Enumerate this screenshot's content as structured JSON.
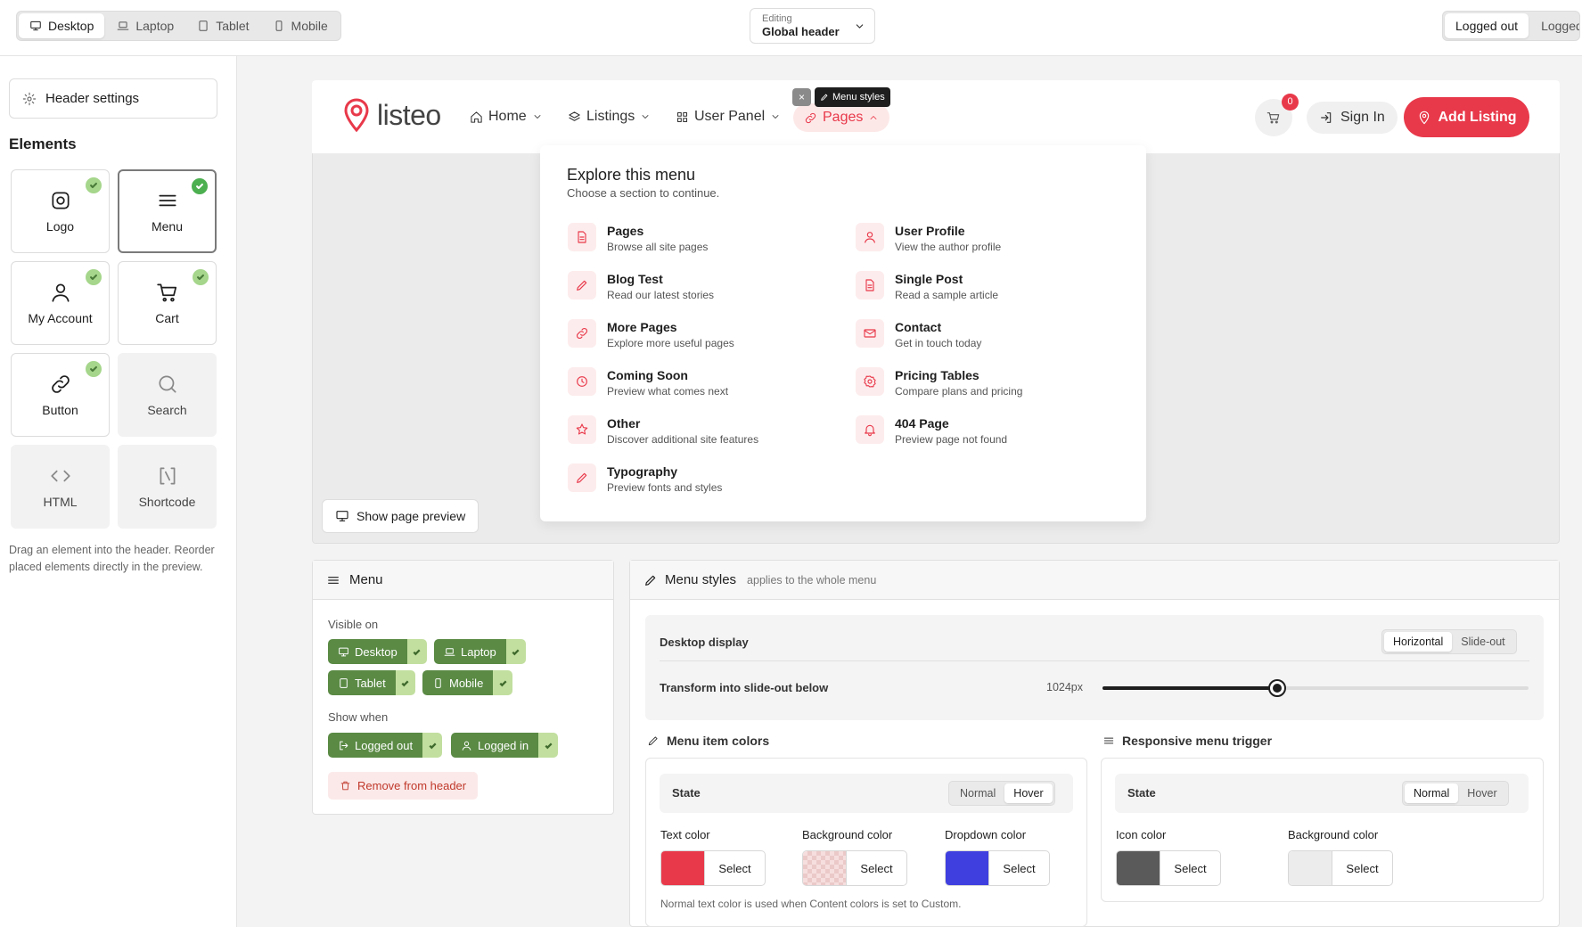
{
  "topbar": {
    "devices": [
      {
        "label": "Desktop",
        "icon": "desktop-icon",
        "active": true
      },
      {
        "label": "Laptop",
        "icon": "laptop-icon",
        "active": false
      },
      {
        "label": "Tablet",
        "icon": "tablet-icon",
        "active": false
      },
      {
        "label": "Mobile",
        "icon": "mobile-icon",
        "active": false
      }
    ],
    "editing_label": "Editing",
    "editing_value": "Global header",
    "login_states": [
      {
        "label": "Logged out",
        "active": true
      },
      {
        "label": "Logged in",
        "active": false
      }
    ]
  },
  "sidebar": {
    "settings_label": "Header settings",
    "elements_title": "Elements",
    "elements": [
      {
        "label": "Logo",
        "icon": "instagram-logo-icon",
        "placed": true
      },
      {
        "label": "Menu",
        "icon": "menu-lines-icon",
        "placed": true,
        "selected": true
      },
      {
        "label": "My Account",
        "icon": "user-icon",
        "placed": true
      },
      {
        "label": "Cart",
        "icon": "cart-icon",
        "placed": true
      },
      {
        "label": "Button",
        "icon": "link-icon",
        "placed": true
      },
      {
        "label": "Search",
        "icon": "search-icon",
        "placed": false
      },
      {
        "label": "HTML",
        "icon": "code-icon",
        "placed": false
      },
      {
        "label": "Shortcode",
        "icon": "shortcode-icon",
        "placed": false
      }
    ],
    "hint": "Drag an element into the header. Reorder placed elements directly in the preview."
  },
  "header": {
    "brand": "listeo",
    "nav": [
      {
        "label": "Home",
        "icon": "home-icon"
      },
      {
        "label": "Listings",
        "icon": "layers-icon"
      },
      {
        "label": "User Panel",
        "icon": "grid-icon"
      },
      {
        "label": "Pages",
        "icon": "link-icon",
        "active": true
      }
    ],
    "menu_styles_badge": "Menu styles",
    "close_glyph": "×",
    "cart_count": "0",
    "sign_in": "Sign In",
    "add_listing": "Add Listing",
    "accent": "#e8394a"
  },
  "dropdown": {
    "title": "Explore this menu",
    "subtitle": "Choose a section to continue.",
    "left": [
      {
        "title": "Pages",
        "desc": "Browse all site pages",
        "icon": "file-icon"
      },
      {
        "title": "Blog Test",
        "desc": "Read our latest stories",
        "icon": "pencil-icon"
      },
      {
        "title": "More Pages",
        "desc": "Explore more useful pages",
        "icon": "link-icon"
      },
      {
        "title": "Coming Soon",
        "desc": "Preview what comes next",
        "icon": "clock-icon"
      },
      {
        "title": "Other",
        "desc": "Discover additional site features",
        "icon": "star-icon"
      },
      {
        "title": "Typography",
        "desc": "Preview fonts and styles",
        "icon": "pencil-icon"
      }
    ],
    "right": [
      {
        "title": "User Profile",
        "desc": "View the author profile",
        "icon": "user-icon"
      },
      {
        "title": "Single Post",
        "desc": "Read a sample article",
        "icon": "file-icon"
      },
      {
        "title": "Contact",
        "desc": "Get in touch today",
        "icon": "mail-icon"
      },
      {
        "title": "Pricing Tables",
        "desc": "Compare plans and pricing",
        "icon": "badge-icon"
      },
      {
        "title": "404 Page",
        "desc": "Preview page not found",
        "icon": "bell-icon"
      }
    ]
  },
  "preview_button": "Show page preview",
  "menu_panel": {
    "title": "Menu",
    "visible_on_label": "Visible on",
    "devices": [
      "Desktop",
      "Laptop",
      "Tablet",
      "Mobile"
    ],
    "show_when_label": "Show when",
    "states": [
      "Logged out",
      "Logged in"
    ],
    "remove": "Remove from header"
  },
  "styles_panel": {
    "title": "Menu styles",
    "subtitle": "applies to the whole menu",
    "desktop_display_label": "Desktop display",
    "display_options": [
      "Horizontal",
      "Slide-out"
    ],
    "display_selected": "Horizontal",
    "transform_label": "Transform into slide-out below",
    "breakpoint_value": "1024px",
    "breakpoint_fraction": 0.41,
    "item_colors": {
      "title": "Menu item colors",
      "state_label": "State",
      "state_options": [
        "Normal",
        "Hover"
      ],
      "state_selected": "Hover",
      "colors": [
        {
          "label": "Text color",
          "value": "#e8394a"
        },
        {
          "label": "Background color",
          "value": "transparent"
        },
        {
          "label": "Dropdown color",
          "value": "#3f3fe0"
        }
      ],
      "select_label": "Select",
      "note": "Normal text color is used when Content colors is set to Custom."
    },
    "trigger": {
      "title": "Responsive menu trigger",
      "state_label": "State",
      "state_options": [
        "Normal",
        "Hover"
      ],
      "state_selected": "Normal",
      "colors": [
        {
          "label": "Icon color",
          "value": "#5a5a5a"
        },
        {
          "label": "Background color",
          "value": "#ececec"
        }
      ],
      "select_label": "Select"
    }
  }
}
